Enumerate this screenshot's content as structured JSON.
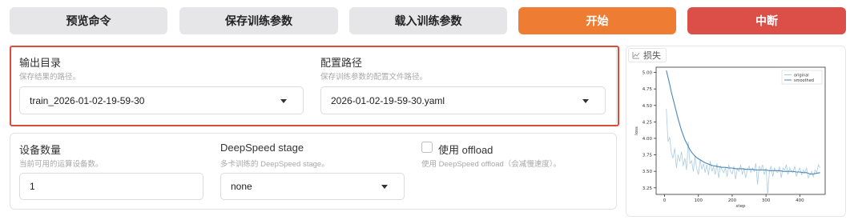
{
  "toolbar": {
    "preview_label": "预览命令",
    "save_label": "保存训练参数",
    "load_label": "载入训练参数",
    "start_label": "开始",
    "abort_label": "中断"
  },
  "output_dir": {
    "label": "输出目录",
    "info": "保存结果的路径。",
    "value": "train_2026-01-02-19-59-30"
  },
  "config_path": {
    "label": "配置路径",
    "info": "保存训练参数的配置文件路径。",
    "value": "2026-01-02-19-59-30.yaml"
  },
  "device_count": {
    "label": "设备数量",
    "info": "当前可用的运算设备数。",
    "value": "1"
  },
  "deepspeed": {
    "label": "DeepSpeed stage",
    "info": "多卡训练的 DeepSpeed stage。",
    "value": "none"
  },
  "offload": {
    "label": "使用 offload",
    "info": "使用 DeepSpeed offload（会减慢速度）。",
    "checked": false
  },
  "plot": {
    "tab_label": "损失"
  },
  "chart_data": {
    "type": "line",
    "xlabel": "step",
    "ylabel": "loss",
    "xlim": [
      -25,
      475
    ],
    "ylim": [
      3.15,
      5.08
    ],
    "xticks": [
      0,
      100,
      200,
      300,
      400
    ],
    "yticks": [
      3.25,
      3.5,
      3.75,
      4.0,
      4.25,
      4.5,
      4.75,
      5.0
    ],
    "legend_position": "top-right",
    "colors": {
      "original": "#a9cce3",
      "smoothed": "#4a86b5"
    },
    "series": [
      {
        "name": "original",
        "x": [
          5,
          10,
          15,
          20,
          25,
          30,
          35,
          40,
          45,
          50,
          55,
          60,
          65,
          70,
          75,
          80,
          85,
          90,
          95,
          100,
          105,
          110,
          115,
          120,
          125,
          130,
          135,
          140,
          145,
          150,
          155,
          160,
          165,
          170,
          175,
          180,
          185,
          190,
          195,
          200,
          205,
          210,
          215,
          220,
          225,
          230,
          235,
          240,
          245,
          250,
          255,
          260,
          265,
          270,
          275,
          280,
          285,
          290,
          295,
          300,
          305,
          310,
          315,
          320,
          325,
          330,
          335,
          340,
          345,
          350,
          355,
          360,
          365,
          370,
          375,
          380,
          385,
          390,
          395,
          400,
          405,
          410,
          415,
          420,
          425,
          430,
          435,
          440,
          445,
          450,
          455,
          460
        ],
        "values": [
          4.45,
          3.95,
          4.02,
          3.78,
          3.7,
          3.85,
          3.55,
          3.75,
          3.65,
          3.8,
          3.58,
          3.7,
          3.52,
          3.95,
          3.62,
          3.66,
          3.5,
          3.72,
          3.55,
          3.45,
          3.68,
          3.53,
          3.62,
          3.48,
          3.6,
          3.44,
          3.66,
          3.5,
          3.57,
          3.45,
          3.62,
          3.4,
          3.58,
          3.52,
          3.48,
          3.55,
          3.42,
          3.6,
          3.5,
          3.46,
          3.58,
          3.38,
          3.54,
          3.5,
          3.6,
          3.45,
          3.55,
          3.4,
          3.52,
          3.58,
          3.48,
          3.55,
          3.5,
          3.62,
          3.3,
          3.58,
          3.52,
          3.6,
          3.45,
          3.55,
          3.15,
          3.5,
          3.58,
          3.42,
          3.55,
          3.5,
          3.48,
          3.57,
          3.4,
          3.55,
          3.52,
          3.6,
          3.45,
          3.55,
          3.5,
          3.48,
          3.58,
          3.42,
          3.5,
          3.55,
          3.45,
          3.52,
          3.48,
          3.55,
          3.4,
          3.45,
          3.5,
          3.42,
          3.52,
          3.48,
          3.6,
          3.55
        ]
      },
      {
        "name": "smoothed",
        "x": [
          5,
          10,
          15,
          20,
          25,
          30,
          35,
          40,
          45,
          50,
          55,
          60,
          65,
          70,
          75,
          80,
          85,
          90,
          95,
          100,
          110,
          120,
          130,
          140,
          150,
          160,
          170,
          180,
          190,
          200,
          210,
          220,
          230,
          240,
          250,
          260,
          270,
          280,
          290,
          300,
          310,
          320,
          330,
          340,
          350,
          360,
          370,
          380,
          390,
          400,
          410,
          420,
          430,
          440,
          450,
          460
        ],
        "values": [
          5.03,
          4.93,
          4.82,
          4.7,
          4.6,
          4.5,
          4.4,
          4.3,
          4.21,
          4.12,
          4.05,
          3.98,
          3.93,
          3.88,
          3.83,
          3.79,
          3.76,
          3.73,
          3.71,
          3.69,
          3.66,
          3.63,
          3.61,
          3.59,
          3.58,
          3.57,
          3.56,
          3.56,
          3.55,
          3.55,
          3.54,
          3.54,
          3.54,
          3.53,
          3.53,
          3.53,
          3.52,
          3.52,
          3.52,
          3.52,
          3.51,
          3.51,
          3.51,
          3.51,
          3.5,
          3.5,
          3.5,
          3.5,
          3.49,
          3.49,
          3.48,
          3.48,
          3.46,
          3.46,
          3.47,
          3.48
        ]
      }
    ]
  }
}
